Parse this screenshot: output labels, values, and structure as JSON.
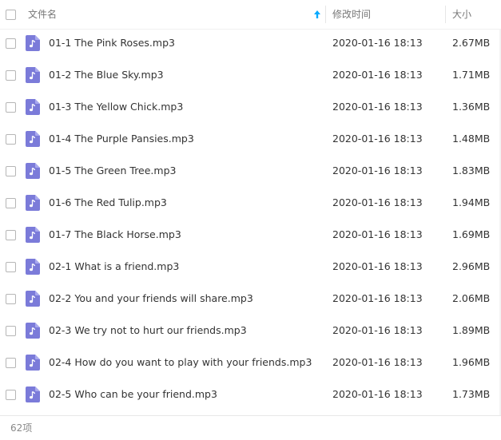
{
  "header": {
    "name_label": "文件名",
    "time_label": "修改时间",
    "size_label": "大小",
    "sort_icon": "sort-ascending-arrow-icon"
  },
  "files": [
    {
      "name": "01-1 The Pink Roses.mp3",
      "time": "2020-01-16 18:13",
      "size": "2.67MB"
    },
    {
      "name": "01-2 The Blue Sky.mp3",
      "time": "2020-01-16 18:13",
      "size": "1.71MB"
    },
    {
      "name": "01-3 The Yellow Chick.mp3",
      "time": "2020-01-16 18:13",
      "size": "1.36MB"
    },
    {
      "name": "01-4 The Purple Pansies.mp3",
      "time": "2020-01-16 18:13",
      "size": "1.48MB"
    },
    {
      "name": "01-5 The Green Tree.mp3",
      "time": "2020-01-16 18:13",
      "size": "1.83MB"
    },
    {
      "name": "01-6 The Red Tulip.mp3",
      "time": "2020-01-16 18:13",
      "size": "1.94MB"
    },
    {
      "name": "01-7 The Black Horse.mp3",
      "time": "2020-01-16 18:13",
      "size": "1.69MB"
    },
    {
      "name": "02-1 What is a friend.mp3",
      "time": "2020-01-16 18:13",
      "size": "2.96MB"
    },
    {
      "name": "02-2 You and your friends will share.mp3",
      "time": "2020-01-16 18:13",
      "size": "2.06MB"
    },
    {
      "name": "02-3 We try not to hurt our friends.mp3",
      "time": "2020-01-16 18:13",
      "size": "1.89MB"
    },
    {
      "name": "02-4 How do you want to play with your friends.mp3",
      "time": "2020-01-16 18:13",
      "size": "1.96MB"
    },
    {
      "name": "02-5 Who can be your friend.mp3",
      "time": "2020-01-16 18:13",
      "size": "1.73MB"
    }
  ],
  "file_icon": "audio-file-icon",
  "colors": {
    "file_icon": "#7b7bd9",
    "sort_arrow": "#09aaff"
  },
  "footer": {
    "count_label": "62项"
  }
}
